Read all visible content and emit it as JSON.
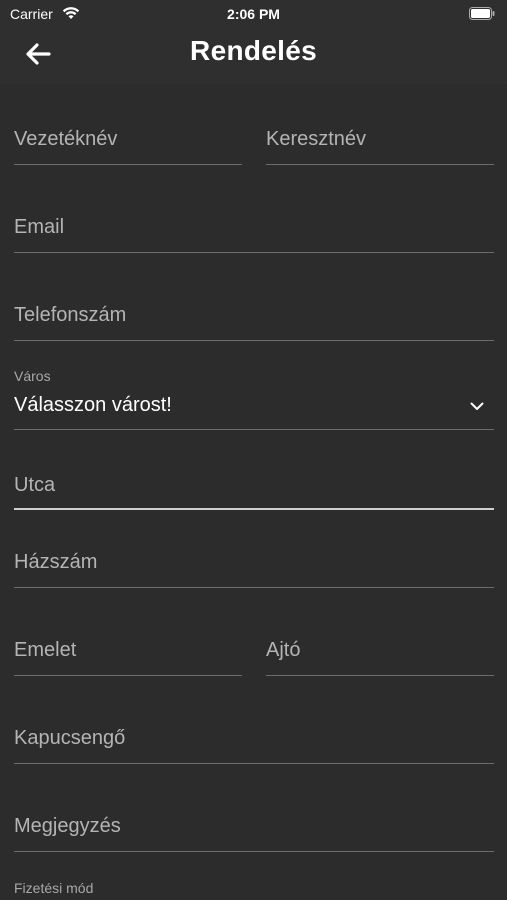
{
  "status_bar": {
    "carrier": "Carrier",
    "time": "2:06 PM",
    "icons": [
      "wifi-icon",
      "battery-icon"
    ]
  },
  "nav": {
    "title": "Rendelés",
    "back_icon": "arrow-left-icon"
  },
  "form": {
    "last_name": {
      "placeholder": "Vezetéknév"
    },
    "first_name": {
      "placeholder": "Keresztnév"
    },
    "email": {
      "placeholder": "Email"
    },
    "phone": {
      "placeholder": "Telefonszám"
    },
    "city": {
      "label": "Város",
      "value": "Válasszon várost!",
      "icon": "chevron-down-icon"
    },
    "street": {
      "placeholder": "Utca"
    },
    "house_number": {
      "placeholder": "Házszám"
    },
    "floor": {
      "placeholder": "Emelet"
    },
    "door": {
      "placeholder": "Ajtó"
    },
    "doorbell": {
      "placeholder": "Kapucsengő"
    },
    "note": {
      "placeholder": "Megjegyzés"
    },
    "payment_method": {
      "label": "Fizetési mód"
    }
  },
  "colors": {
    "background": "#2c2c2c",
    "header": "#2f2f2f",
    "underline": "#6d6d6d",
    "placeholder": "#b4b4b4"
  }
}
